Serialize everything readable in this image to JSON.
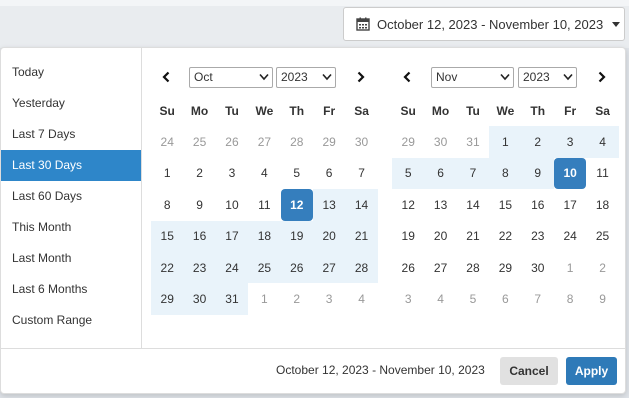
{
  "trigger": {
    "label": "October 12, 2023 - November 10, 2023",
    "icon": "calendar-icon"
  },
  "ranges": [
    {
      "label": "Today",
      "active": false
    },
    {
      "label": "Yesterday",
      "active": false
    },
    {
      "label": "Last 7 Days",
      "active": false
    },
    {
      "label": "Last 30 Days",
      "active": true
    },
    {
      "label": "Last 60 Days",
      "active": false
    },
    {
      "label": "This Month",
      "active": false
    },
    {
      "label": "Last Month",
      "active": false
    },
    {
      "label": "Last 6 Months",
      "active": false
    },
    {
      "label": "Custom Range",
      "active": false
    }
  ],
  "weekdays": [
    "Su",
    "Mo",
    "Tu",
    "We",
    "Th",
    "Fr",
    "Sa"
  ],
  "calendars": [
    {
      "month": "Oct",
      "year": "2023",
      "days": [
        {
          "d": "24",
          "off": true
        },
        {
          "d": "25",
          "off": true
        },
        {
          "d": "26",
          "off": true
        },
        {
          "d": "27",
          "off": true
        },
        {
          "d": "28",
          "off": true
        },
        {
          "d": "29",
          "off": true
        },
        {
          "d": "30",
          "off": true
        },
        {
          "d": "1"
        },
        {
          "d": "2"
        },
        {
          "d": "3"
        },
        {
          "d": "4"
        },
        {
          "d": "5"
        },
        {
          "d": "6"
        },
        {
          "d": "7"
        },
        {
          "d": "8"
        },
        {
          "d": "9"
        },
        {
          "d": "10"
        },
        {
          "d": "11"
        },
        {
          "d": "12",
          "end": true
        },
        {
          "d": "13",
          "in": true
        },
        {
          "d": "14",
          "in": true
        },
        {
          "d": "15",
          "in": true
        },
        {
          "d": "16",
          "in": true
        },
        {
          "d": "17",
          "in": true
        },
        {
          "d": "18",
          "in": true
        },
        {
          "d": "19",
          "in": true
        },
        {
          "d": "20",
          "in": true
        },
        {
          "d": "21",
          "in": true
        },
        {
          "d": "22",
          "in": true
        },
        {
          "d": "23",
          "in": true
        },
        {
          "d": "24",
          "in": true
        },
        {
          "d": "25",
          "in": true
        },
        {
          "d": "26",
          "in": true
        },
        {
          "d": "27",
          "in": true
        },
        {
          "d": "28",
          "in": true
        },
        {
          "d": "29",
          "in": true
        },
        {
          "d": "30",
          "in": true
        },
        {
          "d": "31",
          "in": true
        },
        {
          "d": "1",
          "off": true
        },
        {
          "d": "2",
          "off": true
        },
        {
          "d": "3",
          "off": true
        },
        {
          "d": "4",
          "off": true
        }
      ]
    },
    {
      "month": "Nov",
      "year": "2023",
      "days": [
        {
          "d": "29",
          "off": true
        },
        {
          "d": "30",
          "off": true
        },
        {
          "d": "31",
          "off": true
        },
        {
          "d": "1",
          "in": true
        },
        {
          "d": "2",
          "in": true
        },
        {
          "d": "3",
          "in": true
        },
        {
          "d": "4",
          "in": true
        },
        {
          "d": "5",
          "in": true
        },
        {
          "d": "6",
          "in": true
        },
        {
          "d": "7",
          "in": true
        },
        {
          "d": "8",
          "in": true
        },
        {
          "d": "9",
          "in": true
        },
        {
          "d": "10",
          "end": true
        },
        {
          "d": "11"
        },
        {
          "d": "12"
        },
        {
          "d": "13"
        },
        {
          "d": "14"
        },
        {
          "d": "15"
        },
        {
          "d": "16"
        },
        {
          "d": "17"
        },
        {
          "d": "18"
        },
        {
          "d": "19"
        },
        {
          "d": "20"
        },
        {
          "d": "21"
        },
        {
          "d": "22"
        },
        {
          "d": "23"
        },
        {
          "d": "24"
        },
        {
          "d": "25"
        },
        {
          "d": "26"
        },
        {
          "d": "27"
        },
        {
          "d": "28"
        },
        {
          "d": "29"
        },
        {
          "d": "30"
        },
        {
          "d": "1",
          "off": true
        },
        {
          "d": "2",
          "off": true
        },
        {
          "d": "3",
          "off": true
        },
        {
          "d": "4",
          "off": true
        },
        {
          "d": "5",
          "off": true
        },
        {
          "d": "6",
          "off": true
        },
        {
          "d": "7",
          "off": true
        },
        {
          "d": "8",
          "off": true
        },
        {
          "d": "9",
          "off": true
        }
      ]
    }
  ],
  "footer": {
    "selected_range": "October 12, 2023 - November 10, 2023",
    "cancel_label": "Cancel",
    "apply_label": "Apply"
  },
  "colors": {
    "accent": "#2e86c9",
    "endpoint": "#357ebd",
    "in_range": "#e9f3fa",
    "apply": "#2e7ab8",
    "cancel": "#e1e1e1"
  }
}
